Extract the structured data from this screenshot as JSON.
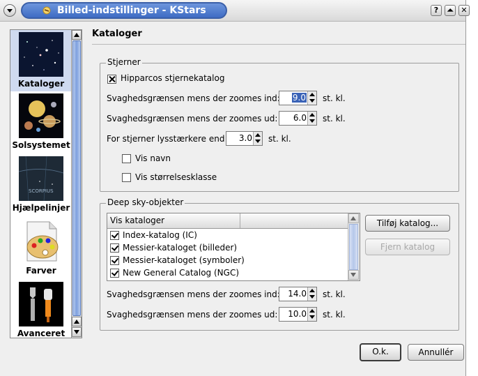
{
  "window": {
    "title": "Billed-indstillinger - KStars",
    "buttons": {
      "help": "?",
      "shade": "⏶",
      "close": "✕"
    }
  },
  "sidebar": {
    "items": [
      {
        "label": "Kataloger",
        "icon": "star-field-icon",
        "selected": true
      },
      {
        "label": "Solsystemet",
        "icon": "planets-icon",
        "selected": false
      },
      {
        "label": "Hjælpelinjer",
        "icon": "constellation-lines-icon",
        "selected": false
      },
      {
        "label": "Farver",
        "icon": "paint-palette-icon",
        "selected": false
      },
      {
        "label": "Avanceret",
        "icon": "tools-icon",
        "selected": false
      }
    ],
    "constellation_text": "SCORPIUS"
  },
  "page": {
    "title": "Kataloger",
    "stars": {
      "group_title": "Stjerner",
      "hipparcos_label": "Hipparcos stjernekatalog",
      "hipparcos_checked": true,
      "zoom_in_label": "Svaghedsgrænsen mens der zoomes ind:",
      "zoom_in_value": "9.0",
      "zoom_out_label": "Svaghedsgrænsen mens der zoomes ud:",
      "zoom_out_value": "6.0",
      "brighter_label": "For stjerner lysstærkere end",
      "brighter_value": "3.0",
      "unit": "st. kl.",
      "show_name_label": "Vis navn",
      "show_name_checked": false,
      "show_mag_label": "Vis størrelsesklasse",
      "show_mag_checked": false
    },
    "deepsky": {
      "group_title": "Deep sky-objekter",
      "list_header": "Vis kataloger",
      "catalogs": [
        {
          "label": "Index-katalog (IC)",
          "checked": true
        },
        {
          "label": "Messier-kataloget (billeder)",
          "checked": true
        },
        {
          "label": "Messier-kataloget (symboler)",
          "checked": true
        },
        {
          "label": "New General Catalog (NGC)",
          "checked": true
        }
      ],
      "add_catalog_button": "Tilføj katalog...",
      "remove_catalog_button": "Fjern katalog",
      "zoom_in_label": "Svaghedsgrænsen mens der zoomes ind:",
      "zoom_in_value": "14.0",
      "zoom_out_label": "Svaghedsgrænsen mens der zoomes ud:",
      "zoom_out_value": "10.0",
      "unit": "st. kl."
    }
  },
  "footer": {
    "ok_button": "O.k.",
    "cancel_button": "Annullér"
  },
  "colors": {
    "title_bar_accent": "#4a78cc",
    "selection_highlight": "#3a63b7",
    "background": "#efefef"
  }
}
